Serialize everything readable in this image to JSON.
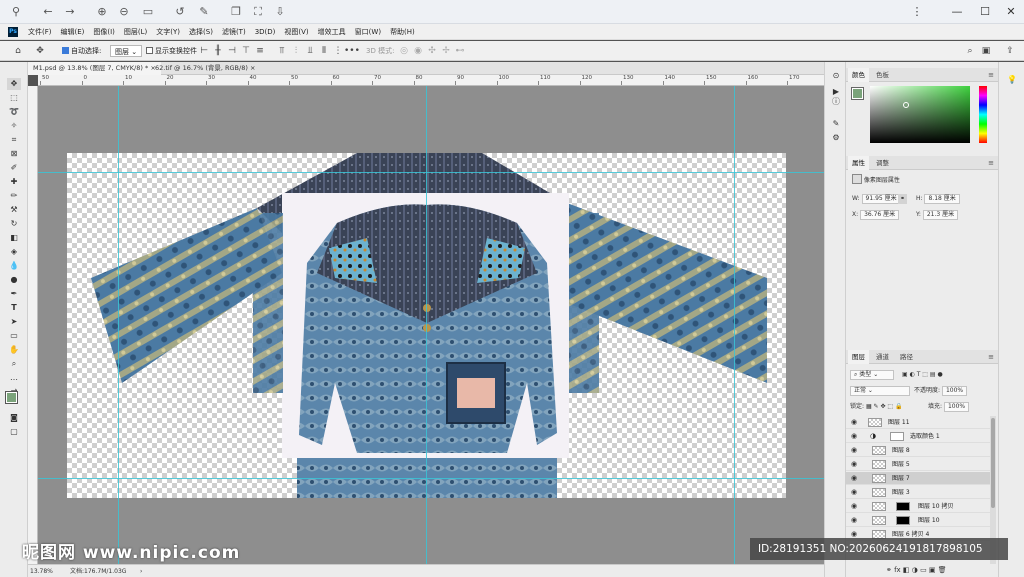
{
  "menu": {
    "items": [
      "文件(F)",
      "编辑(E)",
      "图像(I)",
      "图层(L)",
      "文字(Y)",
      "选择(S)",
      "滤镜(T)",
      "3D(D)",
      "视图(V)",
      "增效工具",
      "窗口(W)",
      "帮助(H)"
    ]
  },
  "options": {
    "auto_select_label": "自动选择:",
    "auto_select_value": "图层",
    "show_transform_label": "显示变换控件",
    "mode_3d_label": "3D 模式:"
  },
  "tabs": [
    {
      "label": "M1.psd @ 13.8% (图层 7, CMYK/8) *",
      "close": "×"
    },
    {
      "label": "62.tif @ 16.7% (背景, RGB/8)",
      "close": "×"
    }
  ],
  "ruler": {
    "top_labels": [
      "50",
      "0",
      "10",
      "20",
      "30",
      "40",
      "50",
      "60",
      "70",
      "80",
      "90",
      "100",
      "110",
      "120",
      "130",
      "140",
      "150",
      "160",
      "170"
    ]
  },
  "status": {
    "zoom": "13.78%",
    "doc": "文档:176.7M/1.03G"
  },
  "color_panel": {
    "tabs": [
      "颜色",
      "色板"
    ],
    "foreground": "#7aa37a"
  },
  "properties_panel": {
    "tabs": [
      "属性",
      "调整"
    ],
    "type_label": "像素图层属性",
    "w_label": "W:",
    "w_value": "91.95 厘米",
    "h_label": "H:",
    "h_value": "8.18 厘米",
    "x_label": "X:",
    "x_value": "36.76 厘米",
    "y_label": "Y:",
    "y_value": "21.3 厘米"
  },
  "layers_panel": {
    "tabs": [
      "图层",
      "通道",
      "路径"
    ],
    "filter_kind": "类型",
    "blend_mode": "正常",
    "opacity_label": "不透明度:",
    "opacity_value": "100%",
    "lock_label": "锁定:",
    "fill_label": "填充:",
    "fill_value": "100%",
    "layers": [
      {
        "name": "图层 11",
        "selected": false,
        "mask": false
      },
      {
        "name": "选取颜色 1",
        "selected": false,
        "mask": false
      },
      {
        "name": "图层 8",
        "selected": false,
        "mask": false
      },
      {
        "name": "图层 5",
        "selected": false,
        "mask": false
      },
      {
        "name": "图层 7",
        "selected": true,
        "mask": false
      },
      {
        "name": "图层 3",
        "selected": false,
        "mask": false
      },
      {
        "name": "图层 10 拷贝",
        "selected": false,
        "mask": true
      },
      {
        "name": "图层 10",
        "selected": false,
        "mask": true
      },
      {
        "name": "图层 6 拷贝 4",
        "selected": false,
        "mask": false
      }
    ]
  },
  "watermark": {
    "logo": "昵图网 www.nipic.com",
    "id": "ID:28191351 NO:20260624191817898105"
  }
}
